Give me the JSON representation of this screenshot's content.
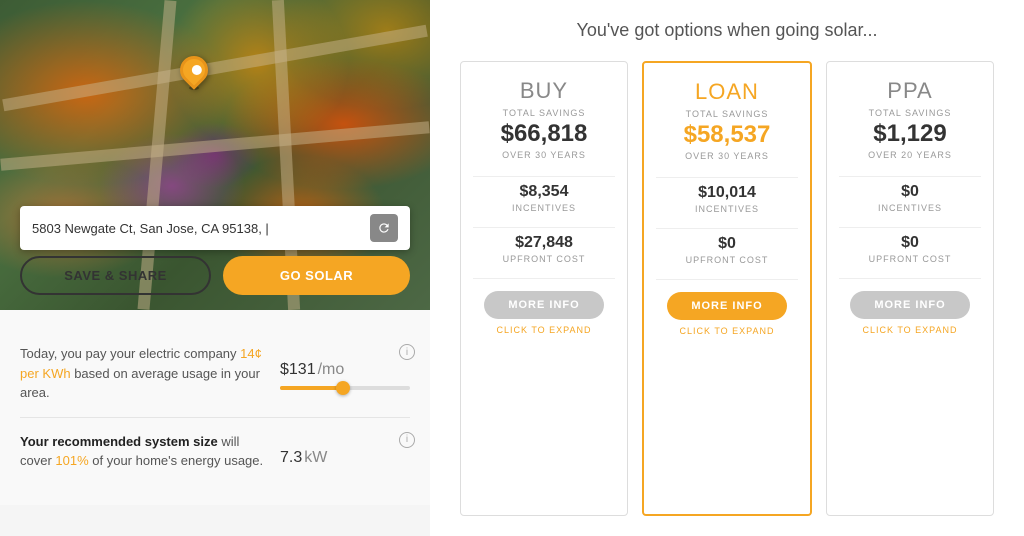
{
  "left": {
    "address": "5803 Newgate Ct, San Jose, CA 95138, |",
    "save_share_label": "SAVE & SHARE",
    "go_solar_label": "GO SOLAR",
    "electric_text_prefix": "Today, you pay your electric company ",
    "electric_rate": "14¢ per KWh",
    "electric_text_suffix": " based on average usage in your area.",
    "electric_value": "$131",
    "electric_unit": "/mo",
    "system_text_prefix": "Your recommended system size will cover ",
    "system_coverage": "101%",
    "system_text_suffix": " of your home's energy usage.",
    "system_value": "7.3",
    "system_unit": "kW"
  },
  "right": {
    "title": "You've got options when going solar...",
    "cards": [
      {
        "type": "BUY",
        "total_savings_label": "TOTAL SAVINGS",
        "savings": "$66,818",
        "period": "OVER 30 YEARS",
        "incentives_value": "$8,354",
        "incentives_label": "INCENTIVES",
        "upfront_value": "$27,848",
        "upfront_label": "UPFRONT COST",
        "more_info_label": "MORE INFO",
        "click_expand_label": "CLICK TO EXPAND",
        "highlighted": false
      },
      {
        "type": "LOAN",
        "total_savings_label": "TOTAL SAVINGS",
        "savings": "$58,537",
        "period": "OVER 30 YEARS",
        "incentives_value": "$10,014",
        "incentives_label": "INCENTIVES",
        "upfront_value": "$0",
        "upfront_label": "UPFRONT COST",
        "more_info_label": "MORE INFO",
        "click_expand_label": "CLICK TO EXPAND",
        "highlighted": true
      },
      {
        "type": "PPA",
        "total_savings_label": "TOTAL SAVINGS",
        "savings": "$1,129",
        "period": "OVER 20 YEARS",
        "incentives_value": "$0",
        "incentives_label": "INCENTIVES",
        "upfront_value": "$0",
        "upfront_label": "UPFRONT COST",
        "more_info_label": "MORE INFO",
        "click_expand_label": "CLICK TO EXPAND",
        "highlighted": false
      }
    ]
  }
}
